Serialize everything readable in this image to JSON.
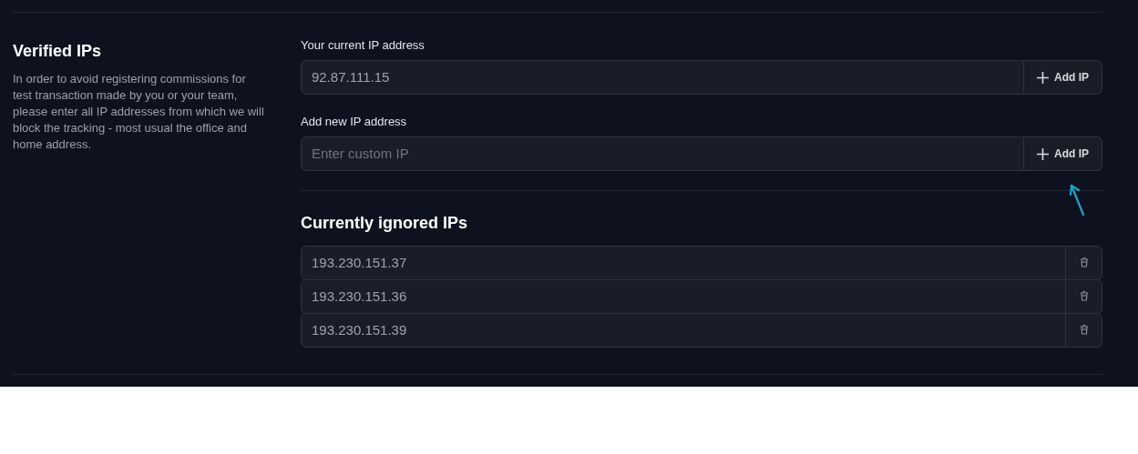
{
  "section": {
    "title": "Verified IPs",
    "description": "In order to avoid registering commissions for test transaction made by you or your team, please enter all IP addresses from which we will block the tracking - most usual the office and home address."
  },
  "current_ip": {
    "label": "Your current IP address",
    "value": "92.87.111.15",
    "button": "Add IP"
  },
  "new_ip": {
    "label": "Add new IP address",
    "placeholder": "Enter custom IP",
    "button": "Add IP"
  },
  "ignored": {
    "title": "Currently ignored IPs",
    "items": [
      {
        "ip": "193.230.151.37"
      },
      {
        "ip": "193.230.151.36"
      },
      {
        "ip": "193.230.151.39"
      }
    ]
  }
}
